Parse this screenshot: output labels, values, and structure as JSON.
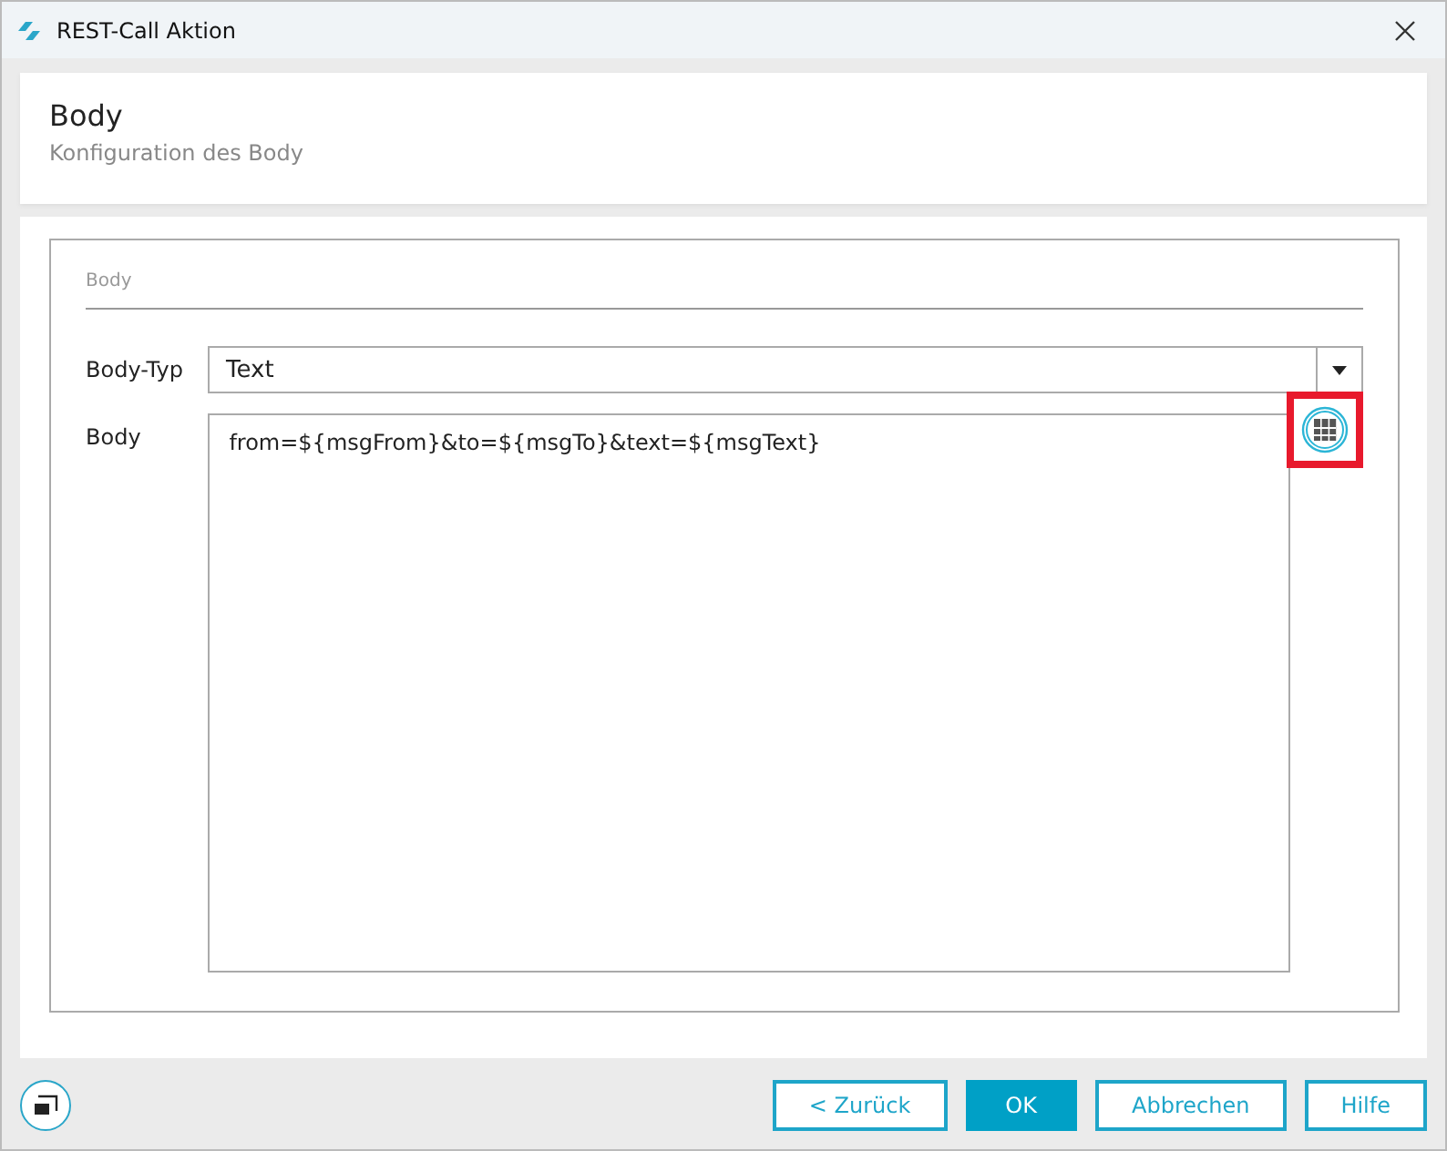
{
  "window": {
    "title": "REST-Call Aktion"
  },
  "header": {
    "title": "Body",
    "subtitle": "Konfiguration des Body"
  },
  "section": {
    "title": "Body"
  },
  "body_type": {
    "label": "Body-Typ",
    "value": "Text"
  },
  "body": {
    "label": "Body",
    "value": "from=${msgFrom}&to=${msgTo}&text=${msgText}",
    "variables_button_highlighted": true
  },
  "buttons": [
    {
      "label": "< Zurück",
      "primary": false
    },
    {
      "label": "OK",
      "primary": true
    },
    {
      "label": "Abbrechen",
      "primary": false
    },
    {
      "label": "Hilfe",
      "primary": false
    }
  ]
}
